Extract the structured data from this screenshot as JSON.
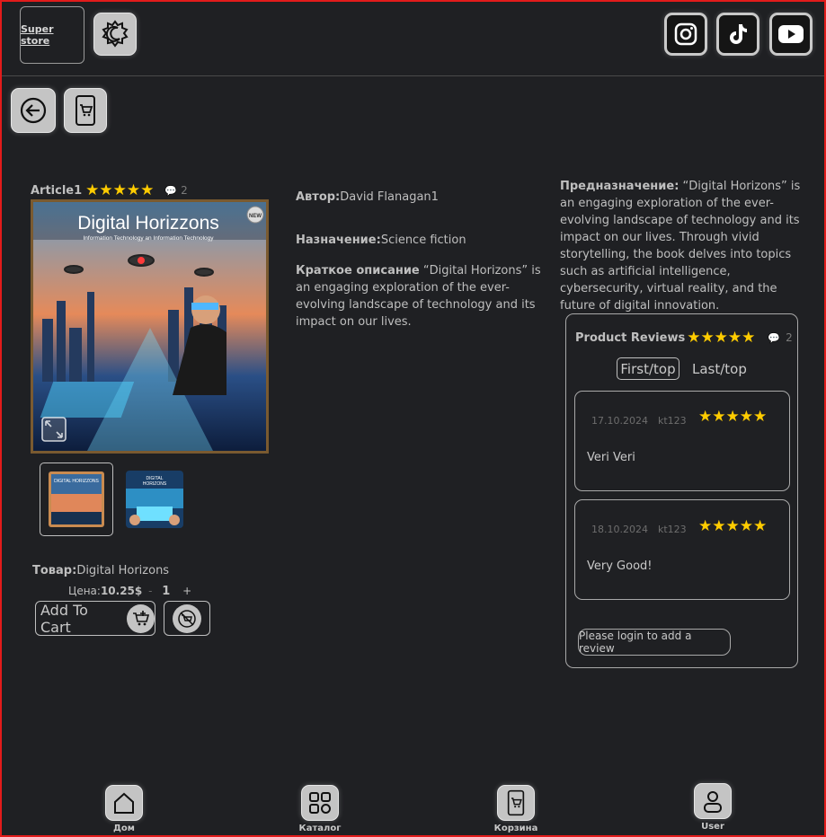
{
  "header": {
    "brand": "Super store",
    "theme_toggle_icon": "moon-sun-icon",
    "socials": [
      "instagram-icon",
      "tiktok-icon",
      "youtube-icon"
    ]
  },
  "toolbar": {
    "back_icon": "arrow-left-icon",
    "cart_phone_icon": "mobile-cart-icon"
  },
  "product": {
    "article": "Article1",
    "rating_stars": "★★★★★",
    "comments_count": "2",
    "cover_title": "Digital Horizzons",
    "cover_subtitle": "Information Technology an Information Technology",
    "cover_badge": "NEW",
    "author_label": "Автор:",
    "author": "David Flanagan1",
    "purpose_label": "Назначение:",
    "purpose": "Science fiction",
    "short_desc_label": "Краткое описание",
    "short_desc": " “Digital Horizons” is an engaging exploration of the ever-evolving landscape of technology and its impact on our lives.",
    "long_desc_label": "Предназначение:",
    "long_desc": " “Digital Horizons” is an engaging exploration of the ever-evolving landscape of technology and its impact on our lives. Through vivid storytelling, the book delves into topics such as artificial intelligence, cybersecurity, virtual reality, and the future of digital innovation.",
    "goods_label": "Товар:",
    "goods_name": "Digital Horizons",
    "price_label": "Цена:",
    "price": "10.25$",
    "qty_minus": "-",
    "quantity": "1",
    "qty_plus": "+",
    "add_to_cart": "Add To Cart"
  },
  "reviews": {
    "title": "Product Reviews",
    "rating_stars": "★★★★★",
    "count": "2",
    "tabs": [
      "First/top",
      "Last/top"
    ],
    "items": [
      {
        "date": "17.10.2024",
        "user": "kt123",
        "stars": "★★★★★",
        "text": "Veri Veri"
      },
      {
        "date": "18.10.2024",
        "user": "kt123",
        "stars": "★★★★★",
        "text": "Very Good!"
      }
    ],
    "login_prompt": "Please login to add a review"
  },
  "nav": [
    {
      "label": "Дом",
      "icon": "home-icon"
    },
    {
      "label": "Каталог",
      "icon": "catalog-grid-icon"
    },
    {
      "label": "Корзина",
      "icon": "mobile-cart-icon"
    },
    {
      "label": "User",
      "icon": "user-icon"
    }
  ],
  "colors": {
    "background": "#1f2023",
    "star": "#ffcc00",
    "border": "#e21b1b",
    "button_bg": "#c4c4c4"
  }
}
